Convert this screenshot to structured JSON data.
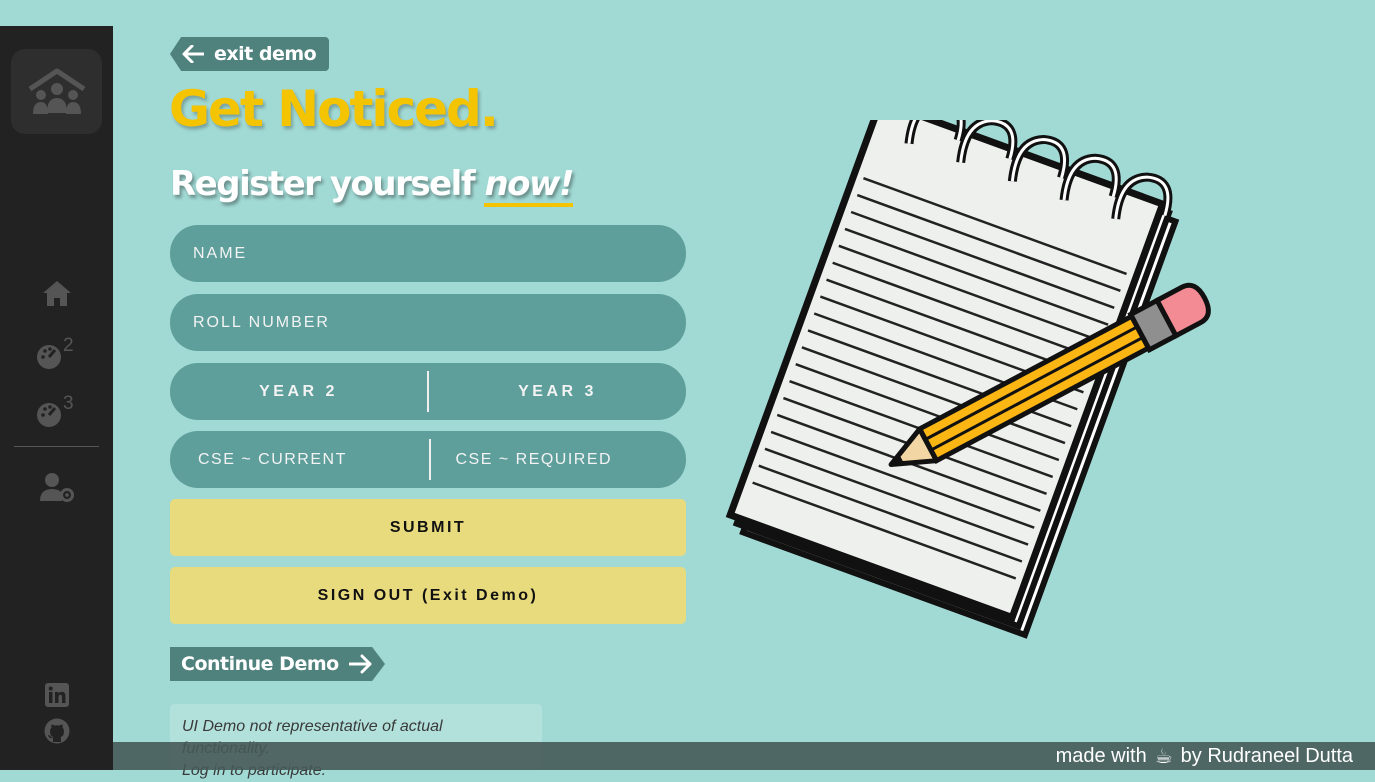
{
  "sidebar": {
    "logo_icon": "family-house-icon",
    "nav": [
      {
        "name": "home",
        "icon": "home-icon"
      },
      {
        "name": "dashboard-year-2",
        "icon": "gauge-icon",
        "superscript": "2"
      },
      {
        "name": "dashboard-year-3",
        "icon": "gauge-icon",
        "superscript": "3"
      },
      {
        "name": "admin",
        "icon": "user-gear-icon"
      }
    ],
    "social": [
      {
        "name": "linkedin",
        "icon": "linkedin-icon"
      },
      {
        "name": "github",
        "icon": "github-icon"
      }
    ]
  },
  "exit_demo_label": "exit demo",
  "headline": "Get Noticed.",
  "subhead": {
    "prefix": "Register yourself ",
    "emphasis": "now!"
  },
  "form": {
    "name_placeholder": "NAME",
    "roll_placeholder": "ROLL NUMBER",
    "year_options": [
      "YEAR 2",
      "YEAR 3"
    ],
    "cse_options": [
      "CSE ~ CURRENT",
      "CSE ~ REQUIRED"
    ],
    "submit_label": "SUBMIT",
    "signout_label": "SIGN OUT (Exit Demo)"
  },
  "continue_demo_label": "Continue Demo",
  "disclaimer": {
    "line1": "UI Demo not representative of actual functionality.",
    "line2": "Log in to participate."
  },
  "footer": {
    "prefix": "made with",
    "icon": "coffee-cup-icon",
    "glyph": "☕",
    "suffix": "by Rudraneel Dutta"
  },
  "colors": {
    "background": "#a1d9d4",
    "sidebar": "#222222",
    "accent_yellow": "#f5c400",
    "field_teal": "#5e9f9c",
    "button_yellow": "#e8db7e",
    "tag_teal": "#4f817d"
  }
}
